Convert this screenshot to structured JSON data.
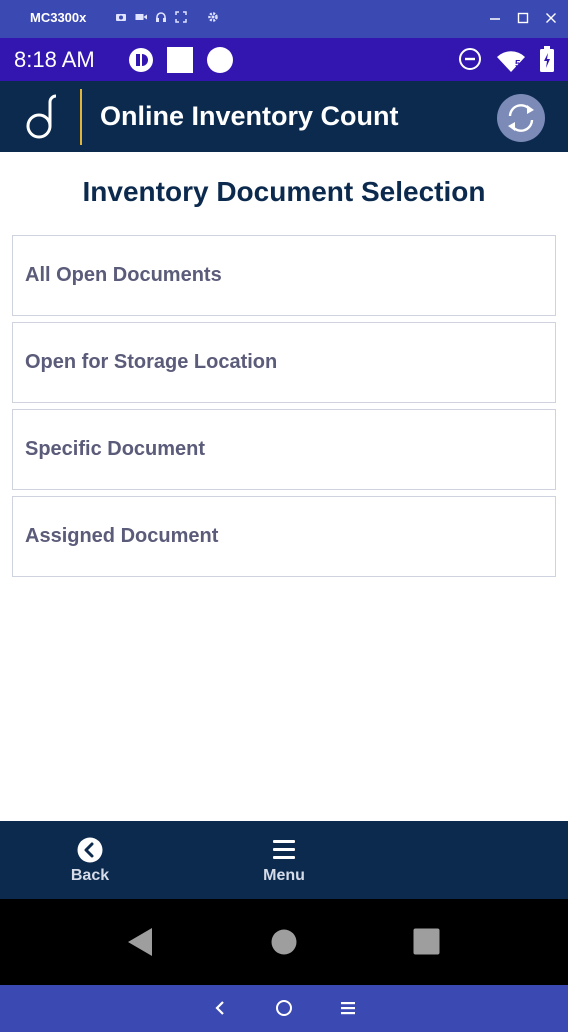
{
  "emulator": {
    "title": "MC3300x",
    "tool_icons": [
      "camera-icon",
      "video-icon",
      "headphones-icon",
      "fullscreen-icon",
      "settings-icon"
    ],
    "window_controls": [
      "minimize-icon",
      "maximize-icon",
      "close-icon"
    ]
  },
  "status_bar": {
    "time": "8:18 AM",
    "left_icons": [
      "app-notification-icon",
      "square-notification-icon",
      "circle-notification-icon"
    ],
    "right_icons": [
      "do-not-disturb-icon",
      "wifi-icon",
      "battery-icon"
    ],
    "wifi_badge": "5"
  },
  "header": {
    "title": "Online Inventory Count",
    "logo": "d",
    "colors": {
      "background": "#0c2a4e",
      "divider": "#e0b63a",
      "refresh": "#7b8ab7"
    }
  },
  "main": {
    "title": "Inventory Document Selection",
    "options": [
      {
        "label": "All Open Documents"
      },
      {
        "label": "Open for Storage Location"
      },
      {
        "label": "Specific Document"
      },
      {
        "label": "Assigned Document"
      }
    ]
  },
  "bottom_bar": {
    "back_label": "Back",
    "menu_label": "Menu"
  },
  "android_nav": [
    "back-triangle-icon",
    "home-circle-icon",
    "recents-square-icon"
  ],
  "emulator_nav": [
    "chevron-left-icon",
    "circle-home-icon",
    "hamburger-icon"
  ]
}
